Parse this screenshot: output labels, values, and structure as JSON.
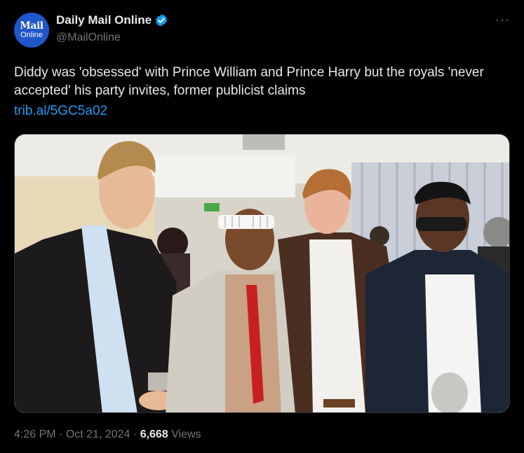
{
  "account": {
    "avatar_line1": "Mail",
    "avatar_line2": "Online",
    "display_name": "Daily Mail Online",
    "handle": "@MailOnline",
    "more": "···"
  },
  "tweet": {
    "text": "Diddy was 'obsessed' with Prince William and Prince Harry but the royals 'never accepted' his party invites, former publicist claims",
    "link": "trib.al/5GC5a02"
  },
  "meta": {
    "time": "4:26 PM",
    "sep1": "·",
    "date": "Oct 21, 2024",
    "sep2": "·",
    "views_count": "6,668",
    "views_label": "Views"
  },
  "colors": {
    "accent": "#1d9bf0",
    "verified": "#1d9bf0",
    "avatar_bg": "#1f56c8"
  }
}
